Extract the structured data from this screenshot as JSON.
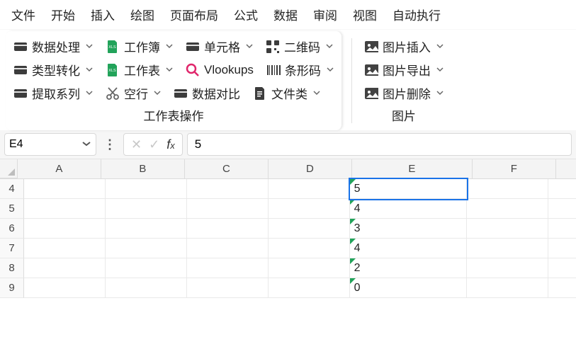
{
  "menubar": [
    "文件",
    "开始",
    "插入",
    "绘图",
    "页面布局",
    "公式",
    "数据",
    "审阅",
    "视图",
    "自动执行"
  ],
  "ribbon": {
    "panel1": {
      "title": "工作表操作",
      "rows": [
        [
          {
            "name": "data-proc",
            "icon": "card-dark",
            "label": "数据处理",
            "chev": true
          },
          {
            "name": "workbook",
            "icon": "xls",
            "label": "工作簿",
            "chev": true
          },
          {
            "name": "cell",
            "icon": "card-dark",
            "label": "单元格",
            "chev": true
          },
          {
            "name": "qrcode",
            "icon": "qr",
            "label": "二维码",
            "chev": true
          }
        ],
        [
          {
            "name": "type-conv",
            "icon": "card-dark",
            "label": "类型转化",
            "chev": true
          },
          {
            "name": "worksheet",
            "icon": "xls",
            "label": "工作表",
            "chev": true
          },
          {
            "name": "vlookup",
            "icon": "search",
            "label": "Vlookups",
            "chev": false
          },
          {
            "name": "barcode",
            "icon": "barcode",
            "label": "条形码",
            "chev": true
          }
        ],
        [
          {
            "name": "extract-series",
            "icon": "card-dark",
            "label": "提取系列",
            "chev": true
          },
          {
            "name": "blank-row",
            "icon": "scissors",
            "label": "空行",
            "chev": true
          },
          {
            "name": "data-compare",
            "icon": "card-dark",
            "label": "数据对比",
            "chev": false
          },
          {
            "name": "file-class",
            "icon": "file",
            "label": "文件类",
            "chev": true
          }
        ]
      ]
    },
    "panel2": {
      "title": "图片",
      "rows": [
        [
          {
            "name": "pic-insert",
            "icon": "image",
            "label": "图片插入",
            "chev": true
          }
        ],
        [
          {
            "name": "pic-export",
            "icon": "image",
            "label": "图片导出",
            "chev": true
          }
        ],
        [
          {
            "name": "pic-delete",
            "icon": "image",
            "label": "图片删除",
            "chev": true
          }
        ]
      ]
    }
  },
  "formula_bar": {
    "name_box": "E4",
    "value": "5"
  },
  "grid": {
    "columns": [
      "A",
      "B",
      "C",
      "D",
      "E",
      "F"
    ],
    "rows": [
      {
        "r": 4,
        "E": "5"
      },
      {
        "r": 5,
        "E": "4"
      },
      {
        "r": 6,
        "E": "3"
      },
      {
        "r": 7,
        "E": "4"
      },
      {
        "r": 8,
        "E": "2"
      },
      {
        "r": 9,
        "E": "0"
      }
    ],
    "active_cell": "E4"
  }
}
